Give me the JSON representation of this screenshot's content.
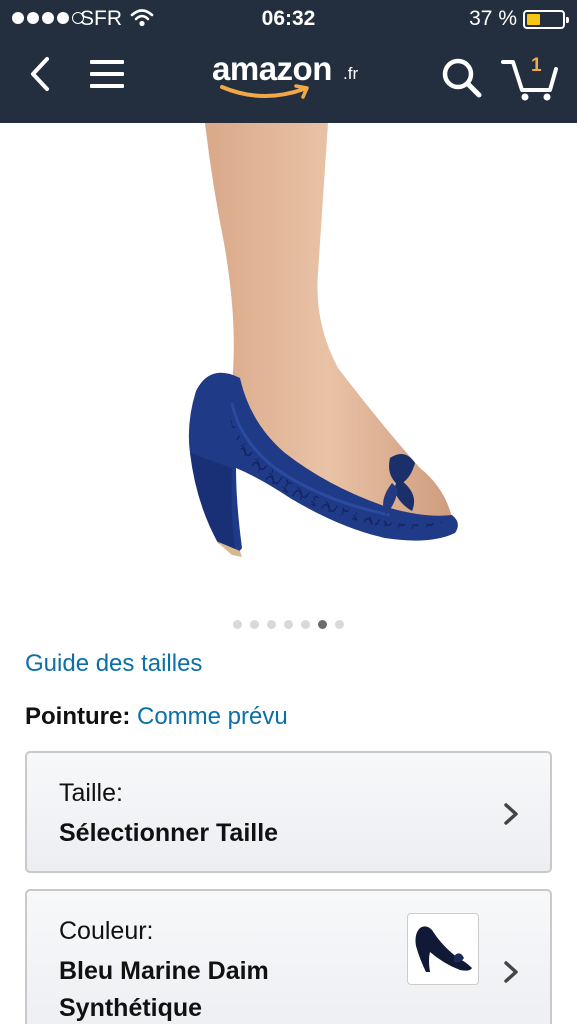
{
  "status_bar": {
    "carrier": "SFR",
    "time": "06:32",
    "battery_percent": "37 %",
    "battery_level": 0.37,
    "signal_bars": 4
  },
  "header": {
    "logo_text": "amazon",
    "logo_tld": ".fr",
    "cart_count": "1",
    "icons": [
      "back-chevron-icon",
      "hamburger-menu-icon",
      "search-icon",
      "cart-icon"
    ],
    "colors": {
      "bar": "#232f3e",
      "accent": "#f3a847"
    }
  },
  "gallery": {
    "total_images": 7,
    "active_index": 5
  },
  "size_guide": {
    "label": "Guide des tailles"
  },
  "pointure": {
    "label": "Pointure:",
    "value": "Comme prévu"
  },
  "size_selector": {
    "label": "Taille:",
    "value": "Sélectionner Taille"
  },
  "color_selector": {
    "label": "Couleur:",
    "value_line1": "Bleu Marine Daim",
    "value_line2": "Synthétique"
  },
  "link_color": "#0b6fa8"
}
